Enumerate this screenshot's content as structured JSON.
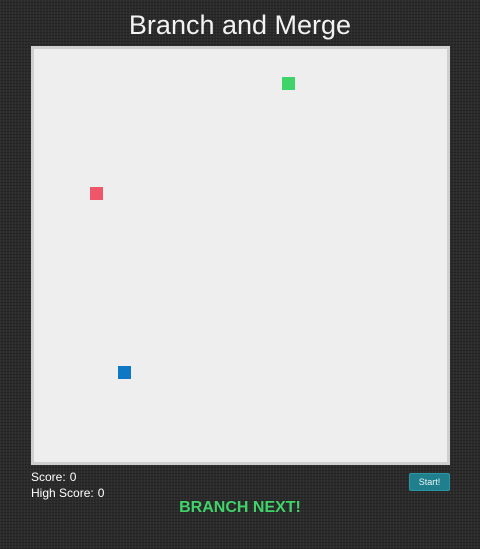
{
  "title": "Branch and Merge",
  "board": {
    "background": "#eeeeee",
    "blocks": [
      {
        "name": "green-block",
        "color": "#3fd46a"
      },
      {
        "name": "red-block",
        "color": "#f0566a"
      },
      {
        "name": "blue-block",
        "color": "#0e78c4"
      }
    ]
  },
  "score": {
    "label": "Score:",
    "value": "0"
  },
  "high_score": {
    "label": "High Score:",
    "value": "0"
  },
  "start_button": {
    "label": "Start!"
  },
  "hint": {
    "text": "BRANCH NEXT!",
    "color": "#3fd46a"
  }
}
